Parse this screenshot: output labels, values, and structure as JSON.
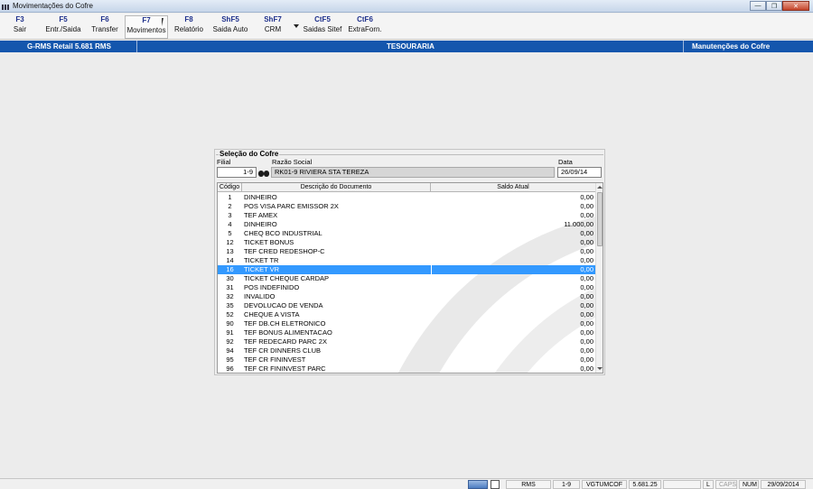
{
  "window": {
    "title": "Movimentações do Cofre"
  },
  "toolbar": {
    "buttons": [
      {
        "key": "F3",
        "label": "Sair"
      },
      {
        "key": "F5",
        "label": "Entr./Saida"
      },
      {
        "key": "F6",
        "label": "Transfer"
      },
      {
        "key": "F7",
        "label": "Movimentos"
      },
      {
        "key": "F8",
        "label": "Relatório"
      },
      {
        "key": "ShF5",
        "label": "Saida Auto"
      },
      {
        "key": "ShF7",
        "label": "CRM"
      },
      {
        "key": "CtF5",
        "label": "Saidas Sitef"
      },
      {
        "key": "CtF6",
        "label": "ExtraForn."
      }
    ]
  },
  "header": {
    "left": "G-RMS Retail 5.681 RMS",
    "center": "TESOURARIA",
    "right": "Manutenções do Cofre"
  },
  "panel": {
    "title": "Seleção do Cofre",
    "filial_label": "Filial",
    "filial_value": "1-9",
    "razao_label": "Razão Social",
    "razao_value": "RK01-9 RIVIERA STA TEREZA",
    "data_label": "Data",
    "data_value": "26/09/14"
  },
  "grid": {
    "columns": [
      "Código",
      "Descrição do Documento",
      "Saldo Atual"
    ],
    "rows": [
      {
        "code": "1",
        "desc": "DINHEIRO",
        "saldo": "0,00"
      },
      {
        "code": "2",
        "desc": "POS VISA PARC EMISSOR  2X",
        "saldo": "0,00"
      },
      {
        "code": "3",
        "desc": "TEF AMEX",
        "saldo": "0,00"
      },
      {
        "code": "4",
        "desc": "DINHEIRO",
        "saldo": "11.000,00"
      },
      {
        "code": "5",
        "desc": "CHEQ BCO INDUSTRIAL",
        "saldo": "0,00"
      },
      {
        "code": "12",
        "desc": "TICKET BONUS",
        "saldo": "0,00"
      },
      {
        "code": "13",
        "desc": "TEF CRED REDESHOP-C",
        "saldo": "0,00"
      },
      {
        "code": "14",
        "desc": "TICKET TR",
        "saldo": "0,00"
      },
      {
        "code": "16",
        "desc": "TICKET VR",
        "saldo": "0,00"
      },
      {
        "code": "30",
        "desc": "TICKET CHEQUE CARDAP",
        "saldo": "0,00"
      },
      {
        "code": "31",
        "desc": "POS INDEFINIDO",
        "saldo": "0,00"
      },
      {
        "code": "32",
        "desc": "INVALIDO",
        "saldo": "0,00"
      },
      {
        "code": "35",
        "desc": "DEVOLUCAO DE VENDA",
        "saldo": "0,00"
      },
      {
        "code": "52",
        "desc": "CHEQUE A VISTA",
        "saldo": "0,00"
      },
      {
        "code": "90",
        "desc": "TEF DB.CH ELETRONICO",
        "saldo": "0,00"
      },
      {
        "code": "91",
        "desc": "TEF BONUS ALIMENTACAO",
        "saldo": "0,00"
      },
      {
        "code": "92",
        "desc": "TEF REDECARD PARC 2X",
        "saldo": "0,00"
      },
      {
        "code": "94",
        "desc": "TEF CR DINNERS CLUB",
        "saldo": "0,00"
      },
      {
        "code": "95",
        "desc": "TEF CR FININVEST",
        "saldo": "0,00"
      },
      {
        "code": "96",
        "desc": "TEF CR FININVEST PARC",
        "saldo": "0,00"
      }
    ],
    "selected_code": "16"
  },
  "statusbar": {
    "system": "RMS",
    "filial": "1-9",
    "program": "VGTUMCOF",
    "version": "5.681.25",
    "blank": "",
    "lock": "L",
    "caps": "CAPS",
    "num": "NUM",
    "date": "29/09/2014"
  },
  "colors": {
    "header_blue": "#1456ad",
    "selection_blue": "#3399ff",
    "toolbar_key": "#1d2f8a"
  },
  "icons": {
    "app": "app-menu-icon",
    "search": "binoculars-icon",
    "network": "network-icon",
    "clipboard": "clipboard-icon"
  }
}
